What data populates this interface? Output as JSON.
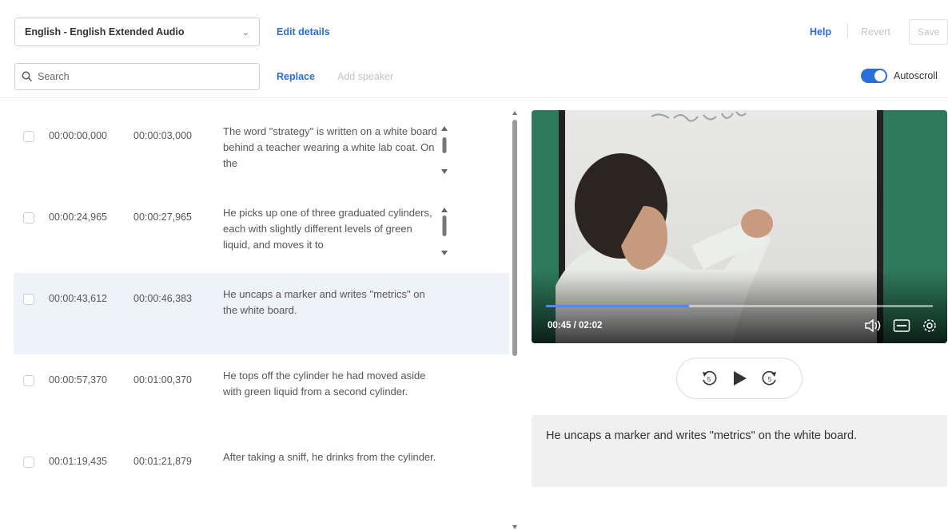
{
  "header": {
    "language_select": "English - English Extended Audio",
    "edit_details": "Edit details",
    "help": "Help",
    "revert": "Revert",
    "save": "Save"
  },
  "toolbar": {
    "search_placeholder": "Search",
    "replace": "Replace",
    "add_speaker": "Add speaker",
    "autoscroll_label": "Autoscroll",
    "autoscroll_on": true
  },
  "captions": [
    {
      "start": "00:00:00,000",
      "end": "00:00:03,000",
      "text": "The word \"strategy\" is written on a white board behind a teacher wearing a white lab coat. On the"
    },
    {
      "start": "00:00:24,965",
      "end": "00:00:27,965",
      "text": "He picks up one of three graduated cylinders, each with slightly different levels of green liquid, and moves it to"
    },
    {
      "start": "00:00:43,612",
      "end": "00:00:46,383",
      "text": "He uncaps a marker and writes \"metrics\" on the white board."
    },
    {
      "start": "00:00:57,370",
      "end": "00:01:00,370",
      "text": "He tops off the cylinder he had moved aside with green liquid from a second cylinder."
    },
    {
      "start": "00:01:19,435",
      "end": "00:01:21,879",
      "text": "After taking a sniff, he drinks from the cylinder."
    }
  ],
  "player": {
    "time": "00:45 / 02:02",
    "progress": 0.37
  },
  "current_caption": "He uncaps a marker and writes \"metrics\" on the white board.",
  "colors": {
    "accent": "#2a6ed8",
    "selected_row": "#eef3fa"
  }
}
